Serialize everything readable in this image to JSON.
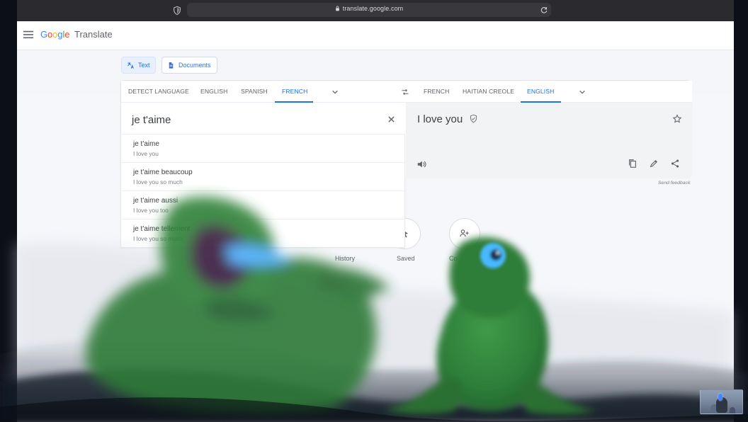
{
  "browser": {
    "url": "translate.google.com"
  },
  "app": {
    "brand_word": "Google",
    "product_name": "Translate"
  },
  "modes": {
    "text": "Text",
    "documents": "Documents"
  },
  "source_languages": [
    {
      "label": "DETECT LANGUAGE"
    },
    {
      "label": "ENGLISH"
    },
    {
      "label": "SPANISH"
    },
    {
      "label": "FRENCH",
      "selected": true
    }
  ],
  "target_languages": [
    {
      "label": "FRENCH"
    },
    {
      "label": "HAITIAN CREOLE"
    },
    {
      "label": "ENGLISH",
      "selected": true
    }
  ],
  "source": {
    "text": "je t'aime"
  },
  "target": {
    "text": "I love you"
  },
  "suggestions": [
    {
      "main": "je t'aime",
      "sub": "I love you"
    },
    {
      "main": "je t'aime beaucoup",
      "sub": "I love you so much"
    },
    {
      "main": "je t'aime aussi",
      "sub": "I love you too"
    },
    {
      "main": "je t'aime tellement",
      "sub": "I love you so much"
    }
  ],
  "footer": {
    "send_feedback": "Send feedback"
  },
  "shortcuts": {
    "history": "History",
    "saved": "Saved",
    "contribute": "Co"
  },
  "icons": {
    "browser_shield": "shield-icon",
    "lock": "lock-icon",
    "reload": "reload-icon",
    "menu": "menu-icon",
    "translate_text": "translate-icon",
    "document": "document-icon",
    "chevron": "chevron-down-icon",
    "swap": "swap-icon",
    "clear": "close-icon",
    "verified": "verified-icon",
    "star": "star-icon",
    "speaker": "speaker-icon",
    "copy": "copy-icon",
    "edit": "edit-icon",
    "share": "share-icon",
    "saved": "pointer-icon",
    "contribute": "people-icon"
  },
  "colors": {
    "accent": "#1a73e8",
    "surface": "#ffffff",
    "target_surface": "#f1f3f4",
    "browser_dark": "#2b2b2f"
  }
}
